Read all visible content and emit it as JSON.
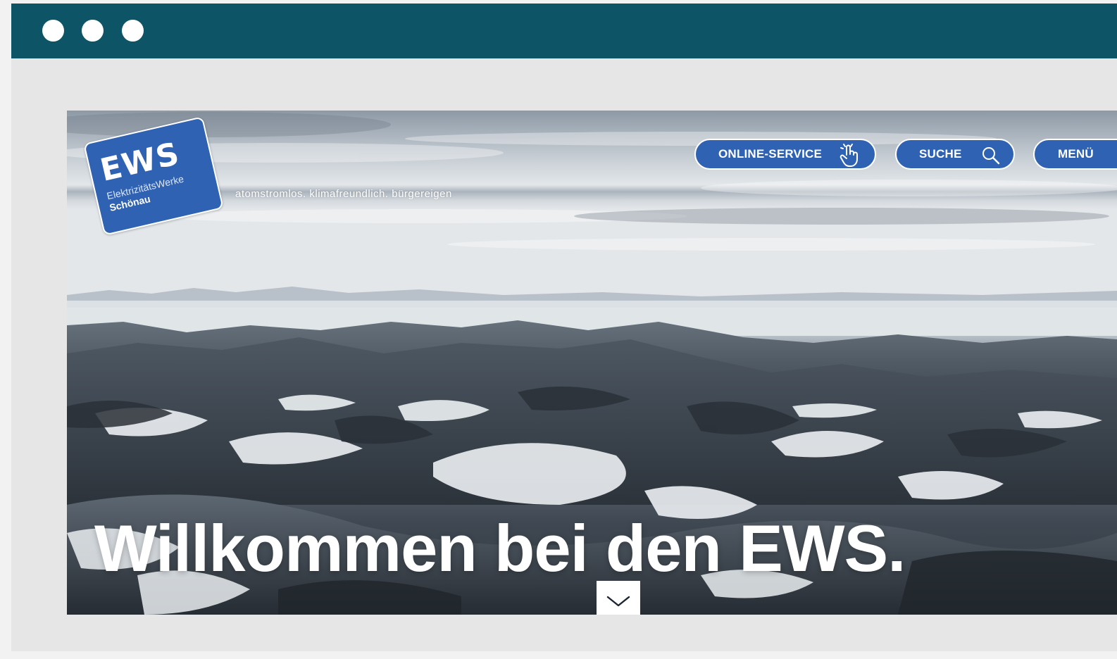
{
  "window": {
    "titlebar_color": "#0d5566",
    "controls": [
      "dot",
      "dot",
      "dot"
    ]
  },
  "header": {
    "logo": {
      "title": "EWS",
      "line1": "ElektrizitätsWerke",
      "line2": "Schönau",
      "color": "#2f62b3"
    },
    "tagline": "atomstromlos. klimafreundlich. bürgereigen",
    "nav": {
      "online_service_label": "ONLINE-SERVICE",
      "online_service_icon": "hand-pointer-icon",
      "search_label": "SUCHE",
      "search_icon": "search-icon",
      "menu_label": "MENÜ"
    }
  },
  "hero": {
    "headline": "Willkommen bei den EWS.",
    "scroll_icon": "chevron-down-icon",
    "image_description_icon": "snowy-mountain-landscape"
  }
}
